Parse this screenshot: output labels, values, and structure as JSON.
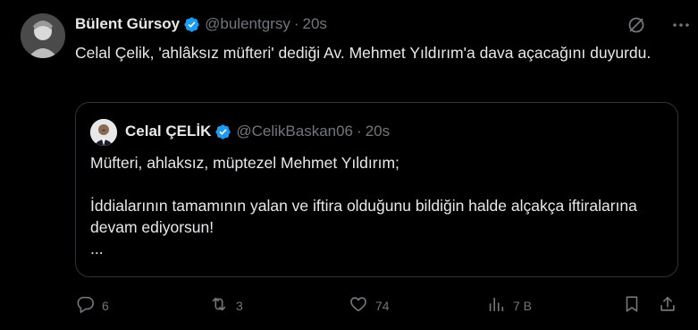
{
  "author": {
    "name": "Bülent Gürsoy",
    "handle": "@bulentgrsy",
    "separator": "·",
    "time": "20s"
  },
  "tweet_text": "Celal Çelik, 'ahlâksız müfteri' dediği Av. Mehmet Yıldırım'a dava açacağını duyurdu.",
  "quoted": {
    "name": "Celal ÇELİK",
    "handle": "@CelikBaskan06",
    "separator": "·",
    "time": "20s",
    "line1": "Müfteri, ahlaksız, müptezel Mehmet Yıldırım;",
    "line2": "İddialarının tamamının yalan ve iftira olduğunu bildiğin halde alçakça iftiralarına devam ediyorsun!",
    "line3": "..."
  },
  "actions": {
    "replies": "6",
    "retweets": "3",
    "likes": "74",
    "views": "7 B"
  },
  "icons": [
    "verified-badge-icon",
    "grok-icon",
    "more-icon",
    "reply-icon",
    "retweet-icon",
    "like-icon",
    "views-icon",
    "bookmark-icon",
    "share-icon"
  ],
  "colors": {
    "background": "#000000",
    "text": "#e7e9ea",
    "secondary": "#71767b",
    "verified": "#1d9bf0",
    "border": "#2f3336"
  }
}
